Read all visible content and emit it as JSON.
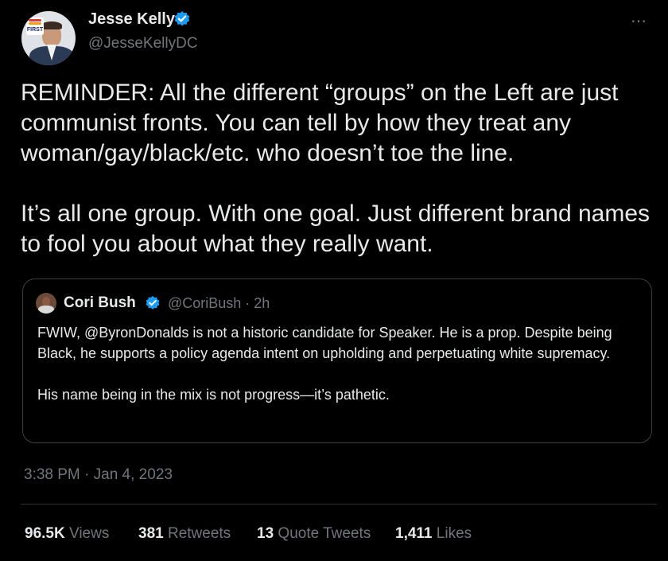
{
  "author": {
    "name": "Jesse Kelly",
    "handle": "@JesseKellyDC",
    "avatar_badge_text": "FIRST"
  },
  "more_icon": "⋯",
  "tweet": {
    "paragraph_1": "REMINDER: All the different “groups” on the Left are just communist fronts. You can tell by how they treat any woman/gay/black/etc. who doesn’t toe the line.",
    "paragraph_2": "It’s all one group. With one goal. Just different brand names to fool you about what they really want."
  },
  "quoted_tweet": {
    "name": "Cori Bush",
    "handle_time": "@CoriBush · 2h",
    "paragraph_1": "FWIW, @ByronDonalds is not a historic candidate for Speaker. He is a prop. Despite being Black, he supports a policy agenda intent on upholding and perpetuating white supremacy.",
    "paragraph_2": "His name being in the mix is not progress—it’s pathetic."
  },
  "timestamp": "3:38 PM · Jan 4, 2023",
  "stats": {
    "views": {
      "num": "96.5K",
      "label": "Views"
    },
    "retweets": {
      "num": "381",
      "label": "Retweets"
    },
    "quote_tweets": {
      "num": "13",
      "label": "Quote Tweets"
    },
    "likes": {
      "num": "1,411",
      "label": "Likes"
    }
  },
  "colors": {
    "background": "#000000",
    "text": "#e7e9ea",
    "secondary": "#71767b",
    "verified": "#1d9bf0"
  }
}
